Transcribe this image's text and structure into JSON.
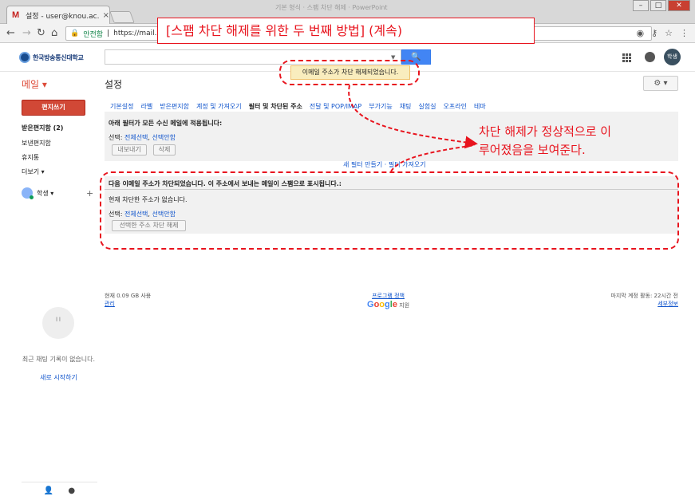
{
  "browser": {
    "tab_title": "설정 - user@knou.ac.kr",
    "tab_close": "×",
    "window_title": "기본 형식 · 스팸 차단 해제 · PowerPoint",
    "secure_label": "안전함",
    "url": "https://mail.goo"
  },
  "header": {
    "logo_text": "한국방송통신대학교",
    "search_button": "🔍",
    "avatar_label": "학생"
  },
  "labels": {
    "mail": "메일 ▾",
    "settings": "설정",
    "gear": "⚙ ▾"
  },
  "banner": "이메일 주소가 차단 해제되었습니다.",
  "sidebar": {
    "compose": "편지쓰기",
    "items": [
      "받은편지함 (2)",
      "보낸편지함",
      "휴지통",
      "더보기 ▾"
    ],
    "user": "학생 ▾",
    "plus": "+",
    "chat_empty": "최근 채팅 기록이 없습니다.",
    "chat_start": "새로 시작하기"
  },
  "tabs": [
    "기본설정",
    "라벨",
    "받은편지함",
    "계정 및 가져오기",
    "필터 및 차단된 주소",
    "전달 및 POP/IMAP",
    "부가기능",
    "채팅",
    "실험실",
    "오프라인",
    "테마"
  ],
  "filters_section": {
    "heading": "아래 필터가 모든 수신 메일에 적용됩니다:",
    "select_label": "선택:",
    "select_all": "전체선택",
    "select_none": "선택안함",
    "export_btn": "내보내기",
    "delete_btn": "삭제",
    "new_filter": "새 필터 만들기",
    "import_filter": "필터 가져오기",
    "separator": " · "
  },
  "blocked_section": {
    "heading": "다음 이메일 주소가 차단되었습니다. 이 주소에서 보내는 메일이 스팸으로 표시됩니다.:",
    "no_address": "현재 차단한 주소가 없습니다.",
    "select_label": "선택:",
    "select_all": "전체선택",
    "select_none": "선택안함",
    "unblock_btn": "선택한 주소 차단 해제"
  },
  "footer": {
    "usage": "현재 0.09 GB 사용",
    "manage": "관리",
    "terms": "프로그램 정책",
    "powered": "지원",
    "last_activity": "마지막 계정 활동: 22시간 전",
    "details": "세부정보"
  },
  "annotation": {
    "title": "[스팸 차단 해제를 위한 두 번째 방법] (계속)",
    "note_line1": "차단 해제가 정상적으로  이",
    "note_line2": "루어졌음을 보여준다."
  },
  "colors": {
    "annotation_red": "#e8141e",
    "gmail_red": "#d14836",
    "link_blue": "#1155cc",
    "banner_yellow": "#f9edbe"
  }
}
